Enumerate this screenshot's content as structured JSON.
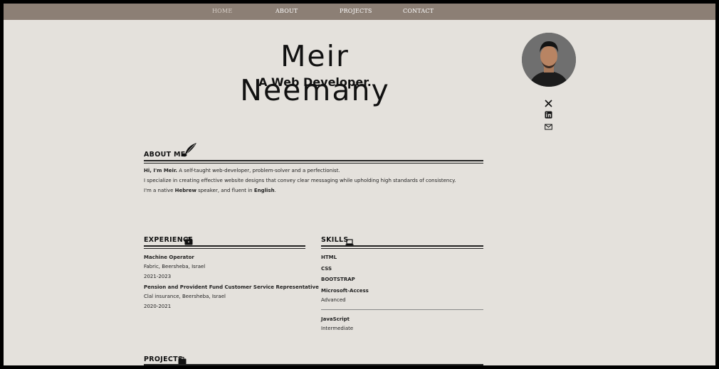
{
  "nav": {
    "items": [
      {
        "label": "HOME",
        "active": true
      },
      {
        "label": "ABOUT"
      },
      {
        "label": "PROJECTS"
      },
      {
        "label": "CONTACT"
      }
    ]
  },
  "hero": {
    "name": "Meir Neemany",
    "subtitle": "A Web Developer."
  },
  "social": {
    "icons": [
      "x-icon",
      "linkedin-icon",
      "mail-icon"
    ]
  },
  "about": {
    "title": "ABOUT ME",
    "line1_bold": "Hi, I'm Meir.",
    "line1_rest": " A self-taught web-developer, problem-solver and a perfectionist.",
    "line2": "I specialize in creating effective website designs that convey clear messaging while upholding high standards of consistency.",
    "line3_a": "I'm a native ",
    "line3_b": "Hebrew",
    "line3_c": " speaker, and fluent in ",
    "line3_d": "English",
    "line3_e": "."
  },
  "experience": {
    "title": "EXPERIENCE",
    "jobs": [
      {
        "role": "Machine Operator",
        "place": "Fabric, Beersheba, Israel",
        "years": "2021-2023"
      },
      {
        "role": "Pension and Provident Fund Customer Service Representative",
        "place": "Clal insurance, Beersheba, Israel",
        "years": "2020-2021"
      }
    ]
  },
  "skills": {
    "title": "SKILLS",
    "items": [
      {
        "name": "HTML"
      },
      {
        "name": "CSS"
      },
      {
        "name": "BOOTSTRAP"
      },
      {
        "name": "Microsoft-Access",
        "level": "Advanced"
      },
      {
        "name": "JavaScript",
        "level": "Intermediate"
      }
    ]
  },
  "projects": {
    "title": "PROJECTS"
  },
  "colors": {
    "nav_bg": "#8c7f75",
    "page_bg": "#e4e1dc",
    "text": "#1a1a1a"
  }
}
